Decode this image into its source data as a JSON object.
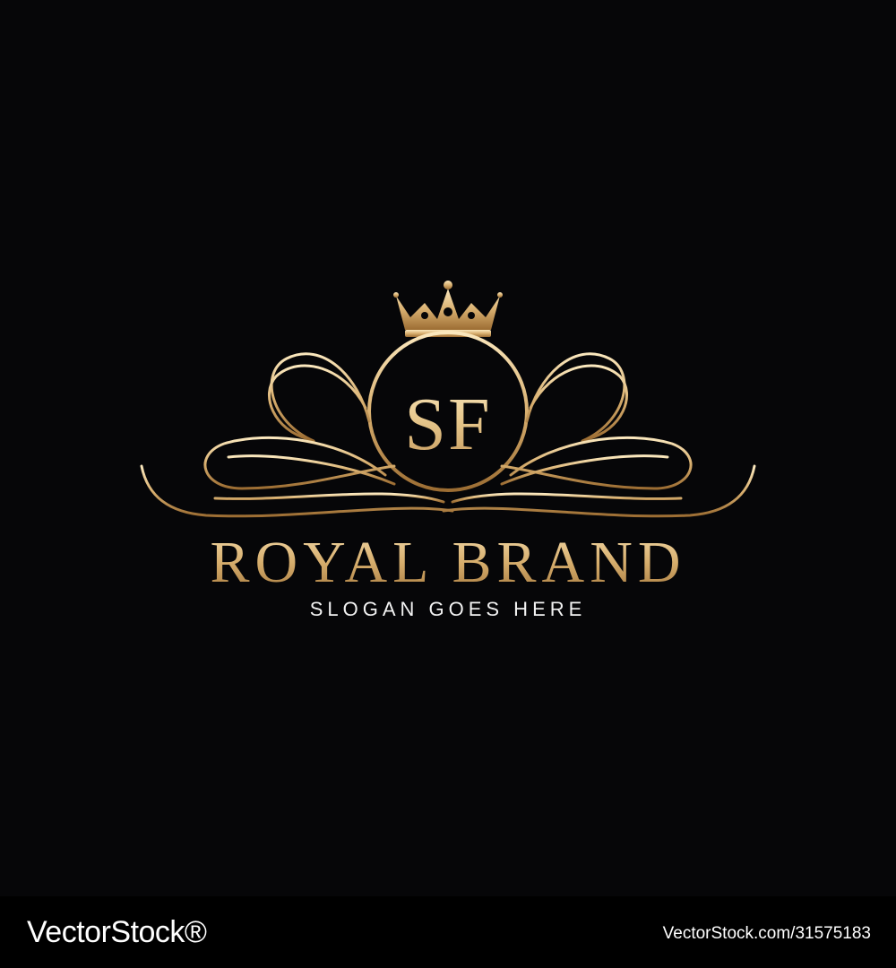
{
  "logo": {
    "monogram": "SF",
    "brand_name": "ROYAL BRAND",
    "slogan": "SLOGAN GOES HERE",
    "icons": [
      "crown-icon",
      "flourish-left-icon",
      "flourish-right-icon",
      "monogram-ring-icon"
    ],
    "colors": {
      "background": "#060608",
      "gold_light": "#f6dfb0",
      "gold_dark": "#9e7138",
      "slogan": "#f2f2f2"
    }
  },
  "footer": {
    "wordmark": "VectorStock®",
    "image_id": "VectorStock.com/31575183"
  }
}
